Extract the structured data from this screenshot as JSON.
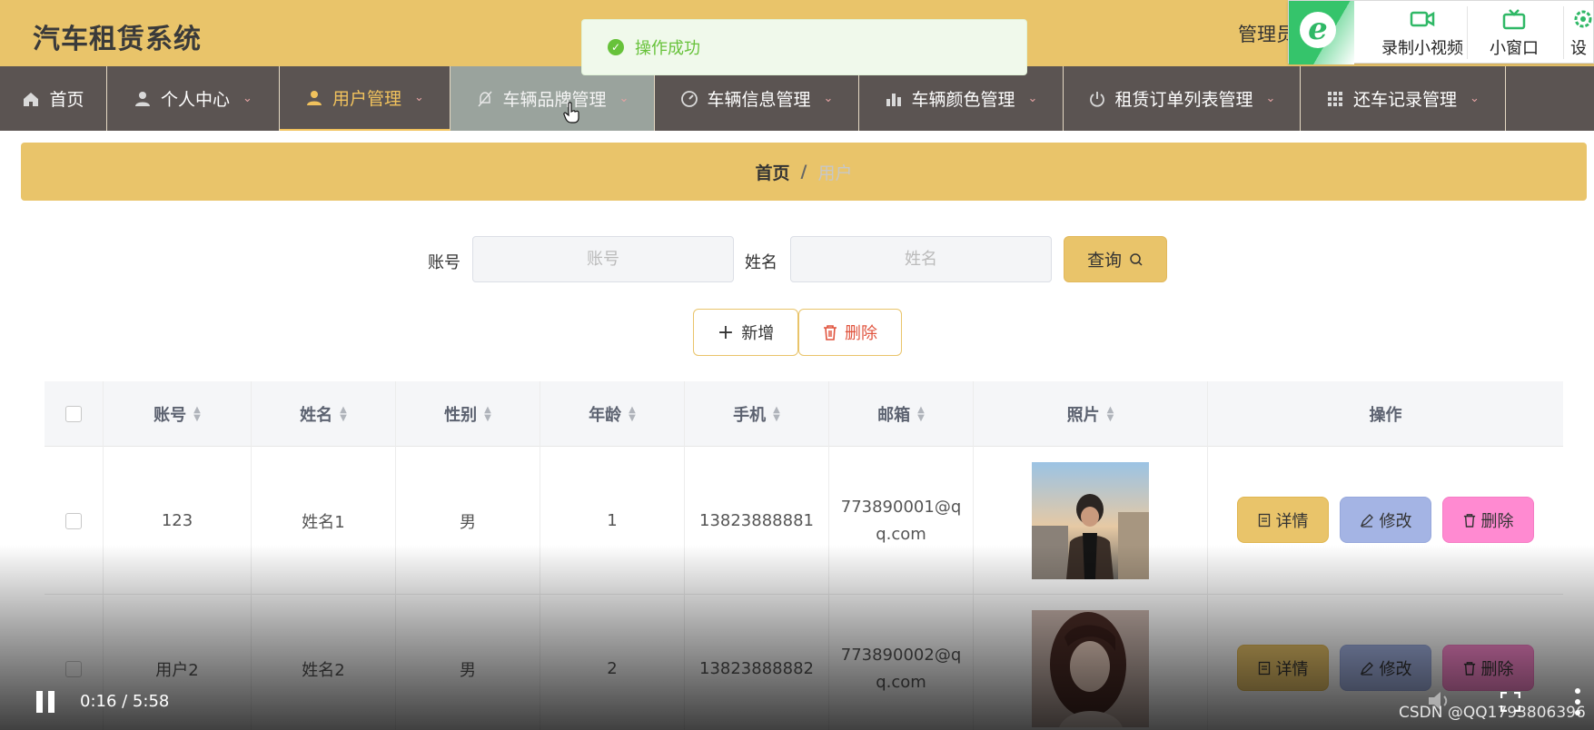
{
  "header": {
    "title": "汽车租赁系统",
    "admin_label": "管理员"
  },
  "browser_toolbar": {
    "record_label": "录制小视频",
    "mini_window_label": "小窗口",
    "settings_label": "设"
  },
  "toast": {
    "message": "操作成功"
  },
  "nav": {
    "items": [
      {
        "label": "首页",
        "icon": "home-icon",
        "has_dropdown": false
      },
      {
        "label": "个人中心",
        "icon": "user-icon",
        "has_dropdown": true
      },
      {
        "label": "用户管理",
        "icon": "user-icon",
        "has_dropdown": true,
        "active": true
      },
      {
        "label": "车辆品牌管理",
        "icon": "bell-off-icon",
        "has_dropdown": true,
        "hover": true
      },
      {
        "label": "车辆信息管理",
        "icon": "gauge-icon",
        "has_dropdown": true
      },
      {
        "label": "车辆颜色管理",
        "icon": "bar-chart-icon",
        "has_dropdown": true
      },
      {
        "label": "租赁订单列表管理",
        "icon": "power-icon",
        "has_dropdown": true
      },
      {
        "label": "还车记录管理",
        "icon": "grid-icon",
        "has_dropdown": true
      }
    ]
  },
  "breadcrumb": {
    "home": "首页",
    "separator": "/",
    "current": "用户"
  },
  "search": {
    "account_label": "账号",
    "account_placeholder": "账号",
    "name_label": "姓名",
    "name_placeholder": "姓名",
    "query_label": "查询"
  },
  "actions": {
    "add_label": "新增",
    "delete_label": "删除"
  },
  "table": {
    "columns": [
      "账号",
      "姓名",
      "性别",
      "年龄",
      "手机",
      "邮箱",
      "照片",
      "操作"
    ],
    "rows": [
      {
        "account": "123",
        "name": "姓名1",
        "gender": "男",
        "age": "1",
        "phone": "13823888881",
        "email": "773890001@qq.com"
      },
      {
        "account": "用户2",
        "name": "姓名2",
        "gender": "男",
        "age": "2",
        "phone": "13823888882",
        "email": "773890002@qq.com"
      }
    ],
    "op_detail": "详情",
    "op_edit": "修改",
    "op_delete": "删除"
  },
  "video": {
    "time": "0:16 / 5:58",
    "watermark": "CSDN @QQ1793806396"
  },
  "colors": {
    "primary": "#e9c46a",
    "nav_bg": "#5b5452",
    "success": "#67c23a",
    "edit": "#a4b4e4",
    "delete": "#ff8ad1"
  }
}
